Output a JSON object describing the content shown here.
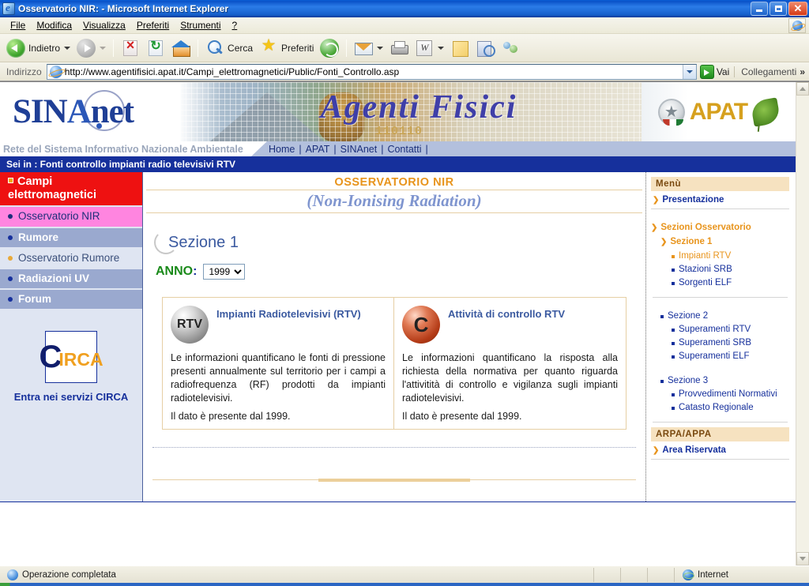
{
  "window": {
    "title": "Osservatorio NIR: - Microsoft Internet Explorer",
    "icon": "ie-document-icon",
    "minimize": "Riduci a icona",
    "restore": "Ripristina",
    "close": "Chiudi"
  },
  "menubar": {
    "items": [
      {
        "label": "File",
        "accel": "F"
      },
      {
        "label": "Modifica",
        "accel": "M"
      },
      {
        "label": "Visualizza",
        "accel": "V"
      },
      {
        "label": "Preferiti",
        "accel": "P"
      },
      {
        "label": "Strumenti",
        "accel": "S"
      },
      {
        "label": "?",
        "accel": ""
      }
    ]
  },
  "toolbar": {
    "back_label": "Indietro",
    "forward_label": "",
    "stop_label": "",
    "refresh_label": "",
    "home_label": "",
    "search_label": "Cerca",
    "favorites_label": "Preferiti",
    "history_label": "",
    "mail_label": "",
    "print_label": "",
    "edit_label": "",
    "notes_label": "",
    "discuss_label": "",
    "messenger_label": ""
  },
  "address": {
    "label": "Indirizzo",
    "url": "http://www.agentifisici.apat.it/Campi_elettromagnetici/Public/Fonti_Controllo.asp",
    "go_label": "Vai",
    "links_label": "Collegamenti",
    "chevron": "»"
  },
  "banner": {
    "logo_sin": "SIN",
    "logo_a": "A",
    "logo_net": "net",
    "site_title": "Agenti Fisici",
    "binary": "110110",
    "agency": "APAT",
    "tagline": "Rete del Sistema Informativo Nazionale Ambientale",
    "nav": [
      {
        "label": "Home"
      },
      {
        "label": "APAT"
      },
      {
        "label": "SINAnet"
      },
      {
        "label": "Contatti"
      }
    ],
    "separator": "|",
    "breadcrumb": "Sei in : Fonti controllo impianti radio televisivi RTV"
  },
  "sidebar": {
    "items": [
      {
        "label": "Campi elettromagnetici",
        "style": "red",
        "marker": "orange-square"
      },
      {
        "label": "Osservatorio NIR",
        "style": "pink",
        "marker": "blue-dot"
      },
      {
        "label": "Rumore",
        "style": "blue",
        "marker": "blue-dot"
      },
      {
        "label": "Osservatorio Rumore",
        "style": "lightblue",
        "marker": "orange-dot"
      },
      {
        "label": "Radiazioni UV",
        "style": "blue",
        "marker": "blue-dot"
      },
      {
        "label": "Forum",
        "style": "blue",
        "marker": "blue-dot"
      }
    ],
    "circa": {
      "logo_c": "C",
      "logo_rest": "IRCA",
      "cta": "Entra nei servizi CIRCA"
    }
  },
  "main": {
    "title": "OSSERVATORIO NIR",
    "subtitle": "(Non-Ionising Radiation)",
    "section_label": "Sezione 1",
    "year_label": "ANNO",
    "year_colon": ":",
    "year_value": "1999",
    "year_options": [
      "1999"
    ],
    "panels": [
      {
        "icon_text": "RTV",
        "icon_style": "gray-sphere",
        "title": "Impianti Radiotelevisivi (RTV)",
        "body": "Le informazioni quantificano le fonti di pressione presenti annualmente sul territorio per i campi a radiofrequenza (RF) prodotti da impianti radiotelevisivi.",
        "note": "Il dato è presente dal 1999."
      },
      {
        "icon_text": "C",
        "icon_style": "red-sphere",
        "title": "Attività di controllo RTV",
        "body": "Le informazioni quantificano la risposta alla richiesta della normativa per quanto riguarda l'attivitità di controllo e vigilanza sugli impianti radiotelevisivi.",
        "note": "Il dato è presente dal 1999."
      }
    ]
  },
  "rightmenu": {
    "header": "Menù",
    "presentation": "Presentazione",
    "groups": [
      {
        "title": "Sezioni Osservatorio",
        "level": "lvl0",
        "children": [
          {
            "label": "Sezione  1",
            "level": "lvl1"
          },
          {
            "label": "Impianti RTV",
            "level": "lvl2"
          },
          {
            "label": "Stazioni SRB",
            "level": "lvl2b"
          },
          {
            "label": "Sorgenti ELF",
            "level": "lvl2b"
          }
        ]
      },
      {
        "title": "Sezione 2",
        "level": "lvl1b",
        "children": [
          {
            "label": "Superamenti RTV",
            "level": "lvl2c"
          },
          {
            "label": "Superamenti SRB",
            "level": "lvl2c"
          },
          {
            "label": "Superamenti ELF",
            "level": "lvl2c"
          }
        ]
      },
      {
        "title": "Sezione 3",
        "level": "lvl1b",
        "children": [
          {
            "label": "Provvedimenti Normativi",
            "level": "lvl2c"
          },
          {
            "label": "Catasto Regionale",
            "level": "lvl2c"
          }
        ]
      }
    ],
    "arpa_header": "ARPA/APPA",
    "arpa_link": "Area Riservata"
  },
  "statusbar": {
    "message": "Operazione completata",
    "zone": "Internet"
  }
}
